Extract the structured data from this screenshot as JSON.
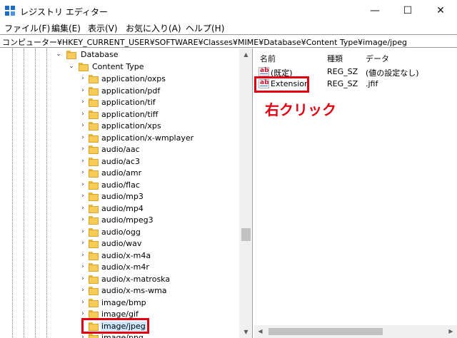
{
  "window": {
    "title": "レジストリ エディター",
    "controls": {
      "minimize": "—",
      "maximize": "☐",
      "close": "✕"
    },
    "app_icon": "registry-editor-icon"
  },
  "menu": [
    "ファイル(F)",
    "編集(E)",
    "表示(V)",
    "お気に入り(A)",
    "ヘルプ(H)"
  ],
  "address": "コンピューター¥HKEY_CURRENT_USER¥SOFTWARE¥Classes¥MIME¥Database¥Content Type¥image/jpeg",
  "tree": {
    "database": "Database",
    "content_type": "Content Type",
    "expanders": {
      "collapsed": "›",
      "expanded": "⌄"
    },
    "items": [
      "application/oxps",
      "application/pdf",
      "application/tif",
      "application/tiff",
      "application/xps",
      "application/x-wmplayer",
      "audio/aac",
      "audio/ac3",
      "audio/amr",
      "audio/flac",
      "audio/mp3",
      "audio/mp4",
      "audio/mpeg3",
      "audio/ogg",
      "audio/wav",
      "audio/x-m4a",
      "audio/x-m4r",
      "audio/x-matroska",
      "audio/x-ms-wma",
      "image/bmp",
      "image/gif",
      "image/jpeg",
      "image/png"
    ],
    "selected": "image/jpeg"
  },
  "values": {
    "headers": {
      "name": "名前",
      "type": "種類",
      "data": "データ"
    },
    "rows": [
      {
        "name": "(既定)",
        "type": "REG_SZ",
        "data": "(値の設定なし)"
      },
      {
        "name": "Extension",
        "type": "REG_SZ",
        "data": ".jfif"
      }
    ]
  },
  "annotation": "右クリック",
  "scroll_arrows": {
    "up": "▲",
    "down": "▼",
    "left": "◀",
    "right": "▶"
  },
  "colors": {
    "highlight_red": "#e00012",
    "folder_yellow": "#f6cb58",
    "selection_blue": "#cce8ff"
  }
}
